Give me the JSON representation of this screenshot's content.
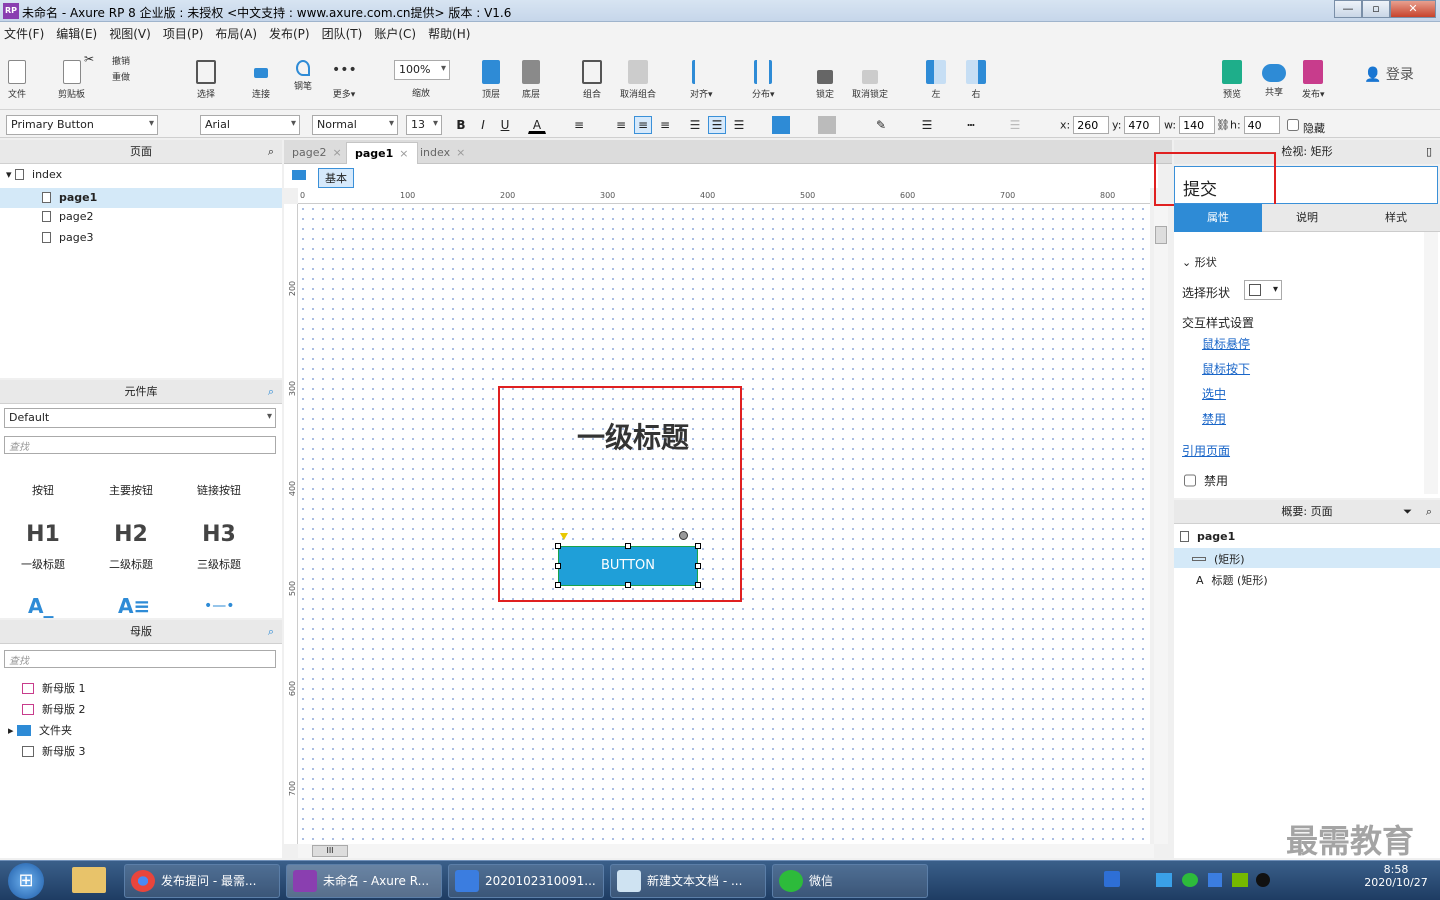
{
  "window": {
    "title": "未命名 - Axure RP 8 企业版 : 未授权     <中文支持 : www.axure.com.cn提供> 版本 : V1.6",
    "app_icon": "RP",
    "min": "—",
    "max": "▫",
    "close": "✕"
  },
  "menu": [
    "文件(F)",
    "编辑(E)",
    "视图(V)",
    "项目(P)",
    "布局(A)",
    "发布(P)",
    "团队(T)",
    "账户(C)",
    "帮助(H)"
  ],
  "toolbar": {
    "file": "文件",
    "clipboard": "剪贴板",
    "cut": "✂",
    "undo": "撤销",
    "redo": "重做",
    "select": "选择",
    "connect": "连接",
    "pen": "钢笔",
    "more": "更多▾",
    "zoom": "100%",
    "zoom_label": "缩放",
    "front": "顶层",
    "back": "底层",
    "group": "组合",
    "ungroup": "取消组合",
    "align": "对齐▾",
    "distribute": "分布▾",
    "lock": "锁定",
    "unlock": "取消锁定",
    "left": "左",
    "right": "右",
    "preview": "预览",
    "share": "共享",
    "publish": "发布▾",
    "login": "登录"
  },
  "format": {
    "style": "Primary Button",
    "font": "Arial",
    "weight": "Normal",
    "size": "13",
    "bold": "B",
    "italic": "I",
    "underline": "U",
    "font_color": "A",
    "x_label": "x:",
    "x": "260",
    "y_label": "y:",
    "y": "470",
    "w_label": "w:",
    "w": "140",
    "h_label": "h:",
    "h": "40",
    "hide": "隐藏"
  },
  "pages_panel": {
    "title": "页面",
    "root": "index",
    "pages": [
      "page1",
      "page2",
      "page3"
    ]
  },
  "library": {
    "title": "元件库",
    "set": "Default",
    "search": "查找",
    "items": [
      "按钮",
      "主要按钮",
      "链接按钮",
      "一级标题",
      "二级标题",
      "三级标题"
    ],
    "h1": "H1",
    "h2": "H2",
    "h3": "H3"
  },
  "masters": {
    "title": "母版",
    "search": "查找",
    "items": [
      "新母版 1",
      "新母版 2",
      "文件夹",
      "新母版 3"
    ]
  },
  "tabs": [
    {
      "label": "page2",
      "x": "×"
    },
    {
      "label": "page1",
      "x": "×"
    },
    {
      "label": "index",
      "x": "×"
    }
  ],
  "canvas": {
    "adaptive": "基本",
    "ruler_h": [
      "0",
      "100",
      "200",
      "300",
      "400",
      "500",
      "600",
      "700",
      "800"
    ],
    "ruler_v": [
      "200",
      "300",
      "400",
      "500",
      "600",
      "700"
    ],
    "heading": "一级标题",
    "button": "BUTTON",
    "scroll": "III"
  },
  "inspector": {
    "title": "检视: 矩形",
    "name": "提交",
    "tabs": [
      "属性",
      "说明",
      "样式"
    ],
    "section": "形状",
    "choose_shape": "选择形状",
    "interaction_styles": "交互样式设置",
    "links": [
      "鼠标悬停",
      "鼠标按下",
      "选中",
      "禁用"
    ],
    "ref_page": "引用页面",
    "disable": "禁用"
  },
  "outline": {
    "title": "概要: 页面",
    "page": "page1",
    "items": [
      "(矩形)",
      "标题 (矩形)"
    ]
  },
  "taskbar": {
    "start": "⊞",
    "tasks": [
      "发布提问 - 最需...",
      "未命名 - Axure R...",
      "2020102310091...",
      "新建文本文档 - ...",
      "微信"
    ],
    "time": "8:58",
    "date": "2020/10/27",
    "watermark": "最需教育"
  },
  "colors": {
    "accent": "#2e8bd6",
    "button_fill": "#1f9fd8",
    "highlight": "#e02020"
  }
}
